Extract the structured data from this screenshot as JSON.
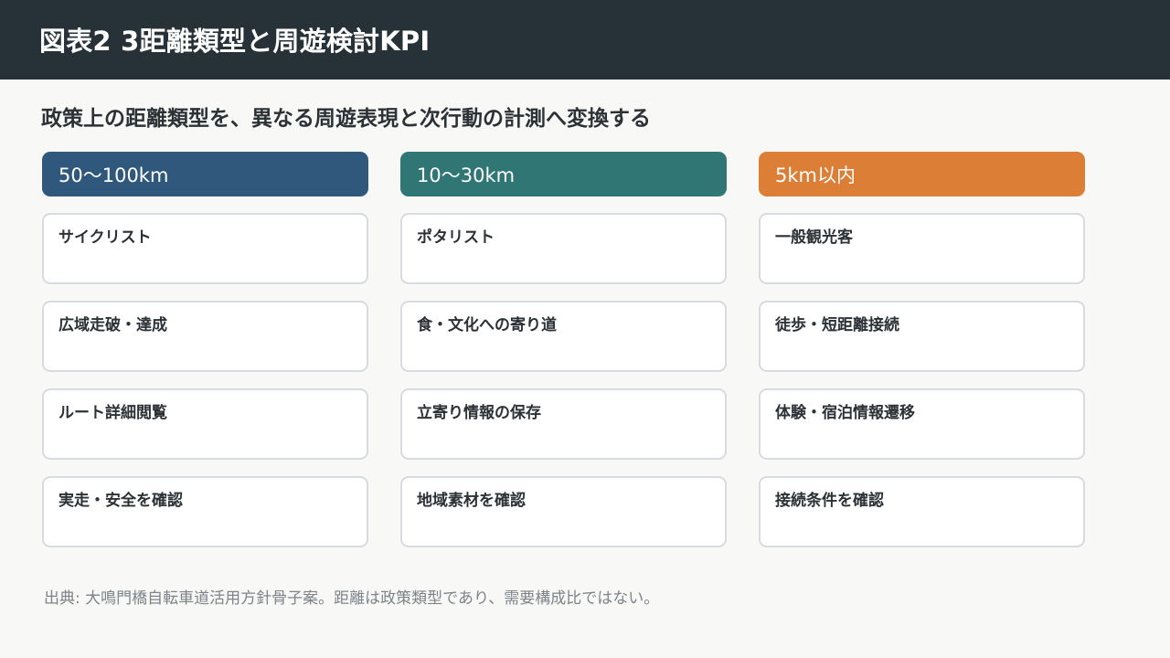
{
  "header": {
    "title": "図表2 3距離類型と周遊検討KPI"
  },
  "subtitle": "政策上の距離類型を、異なる周遊表現と次行動の計測へ変換する",
  "columns": [
    {
      "label": "50〜100km",
      "color": "#30587c",
      "cards": [
        "サイクリスト",
        "広域走破・達成",
        "ルート詳細閲覧",
        "実走・安全を確認"
      ]
    },
    {
      "label": "10〜30km",
      "color": "#2f7674",
      "cards": [
        "ポタリスト",
        "食・文化への寄り道",
        "立寄り情報の保存",
        "地域素材を確認"
      ]
    },
    {
      "label": "5km以内",
      "color": "#dc7e36",
      "cards": [
        "一般観光客",
        "徒歩・短距離接続",
        "体験・宿泊情報遷移",
        "接続条件を確認"
      ]
    }
  ],
  "source_note": "出典: 大鳴門橋自転車道活用方針骨子案。距離は政策類型であり、需要構成比ではない。"
}
